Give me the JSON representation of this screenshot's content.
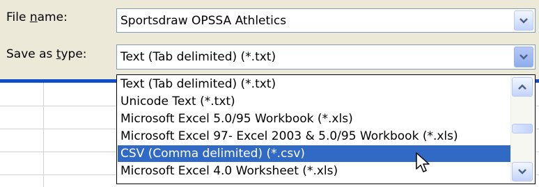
{
  "file_name": {
    "label_pre": "File ",
    "label_accel": "n",
    "label_post": "ame:",
    "value": "Sportsdraw OPSSA Athletics"
  },
  "save_as_type": {
    "label_pre": "Save as ",
    "label_accel": "t",
    "label_post": "ype:",
    "value": "Text (Tab delimited) (*.txt)"
  },
  "type_list": {
    "items": [
      "Text (Tab delimited) (*.txt)",
      "Unicode Text (*.txt)",
      "Microsoft Excel 5.0/95 Workbook (*.xls)",
      "Microsoft Excel 97- Excel 2003 & 5.0/95 Workbook (*.xls)",
      "CSV (Comma delimited) (*.csv)",
      "Microsoft Excel 4.0 Worksheet (*.xls)"
    ],
    "selected_index": 4
  },
  "icons": {
    "dropdown": "chevron-down-icon",
    "scroll_up": "chevron-up-icon",
    "scroll_down": "chevron-down-icon",
    "pointer": "mouse-pointer-icon"
  },
  "colors": {
    "selection": "#316AC5",
    "dialog_bg": "#ECE9D8",
    "band": "#0A4FC9"
  }
}
